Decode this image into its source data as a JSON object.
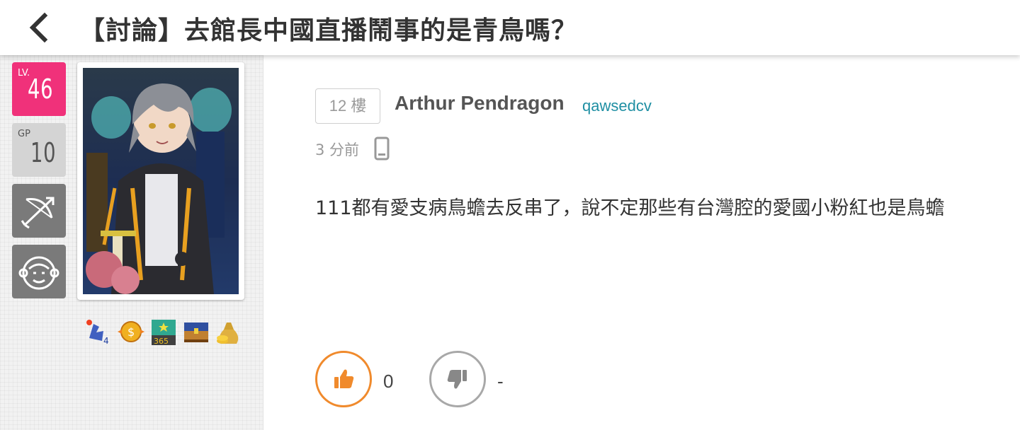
{
  "header": {
    "back_icon": "chevron-left-icon",
    "title": "【討論】去館長中國直播鬧事的是青鳥嗎？"
  },
  "sidebar": {
    "level_label": "LV.",
    "level_value": "46",
    "gp_label": "GP",
    "gp_value": "10",
    "class_icon": "bow-arrow-icon",
    "race_icon": "monkey-face-icon",
    "avatar_icon": "character-avatar",
    "medals": [
      "dragon-medal-icon",
      "coin-medal-icon",
      "365-days-medal-icon",
      "treasure-chest-medal-icon",
      "money-bag-medal-icon"
    ],
    "colors": {
      "level_bg": "#f0317a",
      "gp_bg": "#d4d4d4",
      "icon_bg": "#7a7a7a"
    }
  },
  "post": {
    "floor": "12 樓",
    "author_name": "Arthur Pendragon",
    "author_id": "qawsedcv",
    "time": "3 分前",
    "device_icon": "mobile-phone-icon",
    "content": "111都有愛支病鳥蟾去反串了，說不定那些有台灣腔的愛國小粉紅也是鳥蟾",
    "like_count": "0",
    "dislike_count": "-",
    "colors": {
      "author_id": "#1f8fa3",
      "like": "#f08a2c",
      "dislike": "#a8a8a8"
    }
  }
}
